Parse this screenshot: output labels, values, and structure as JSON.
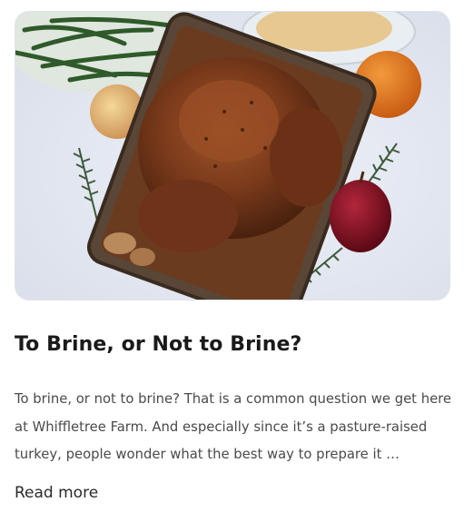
{
  "post": {
    "title": "To Brine, or Not to Brine?",
    "excerpt": "To brine, or not to brine? That is a common question we get here at Whiffletree Farm. And especially since it’s a pasture-raised turkey, people wonder what the best way to prepare it …",
    "read_more_label": "Read more"
  }
}
